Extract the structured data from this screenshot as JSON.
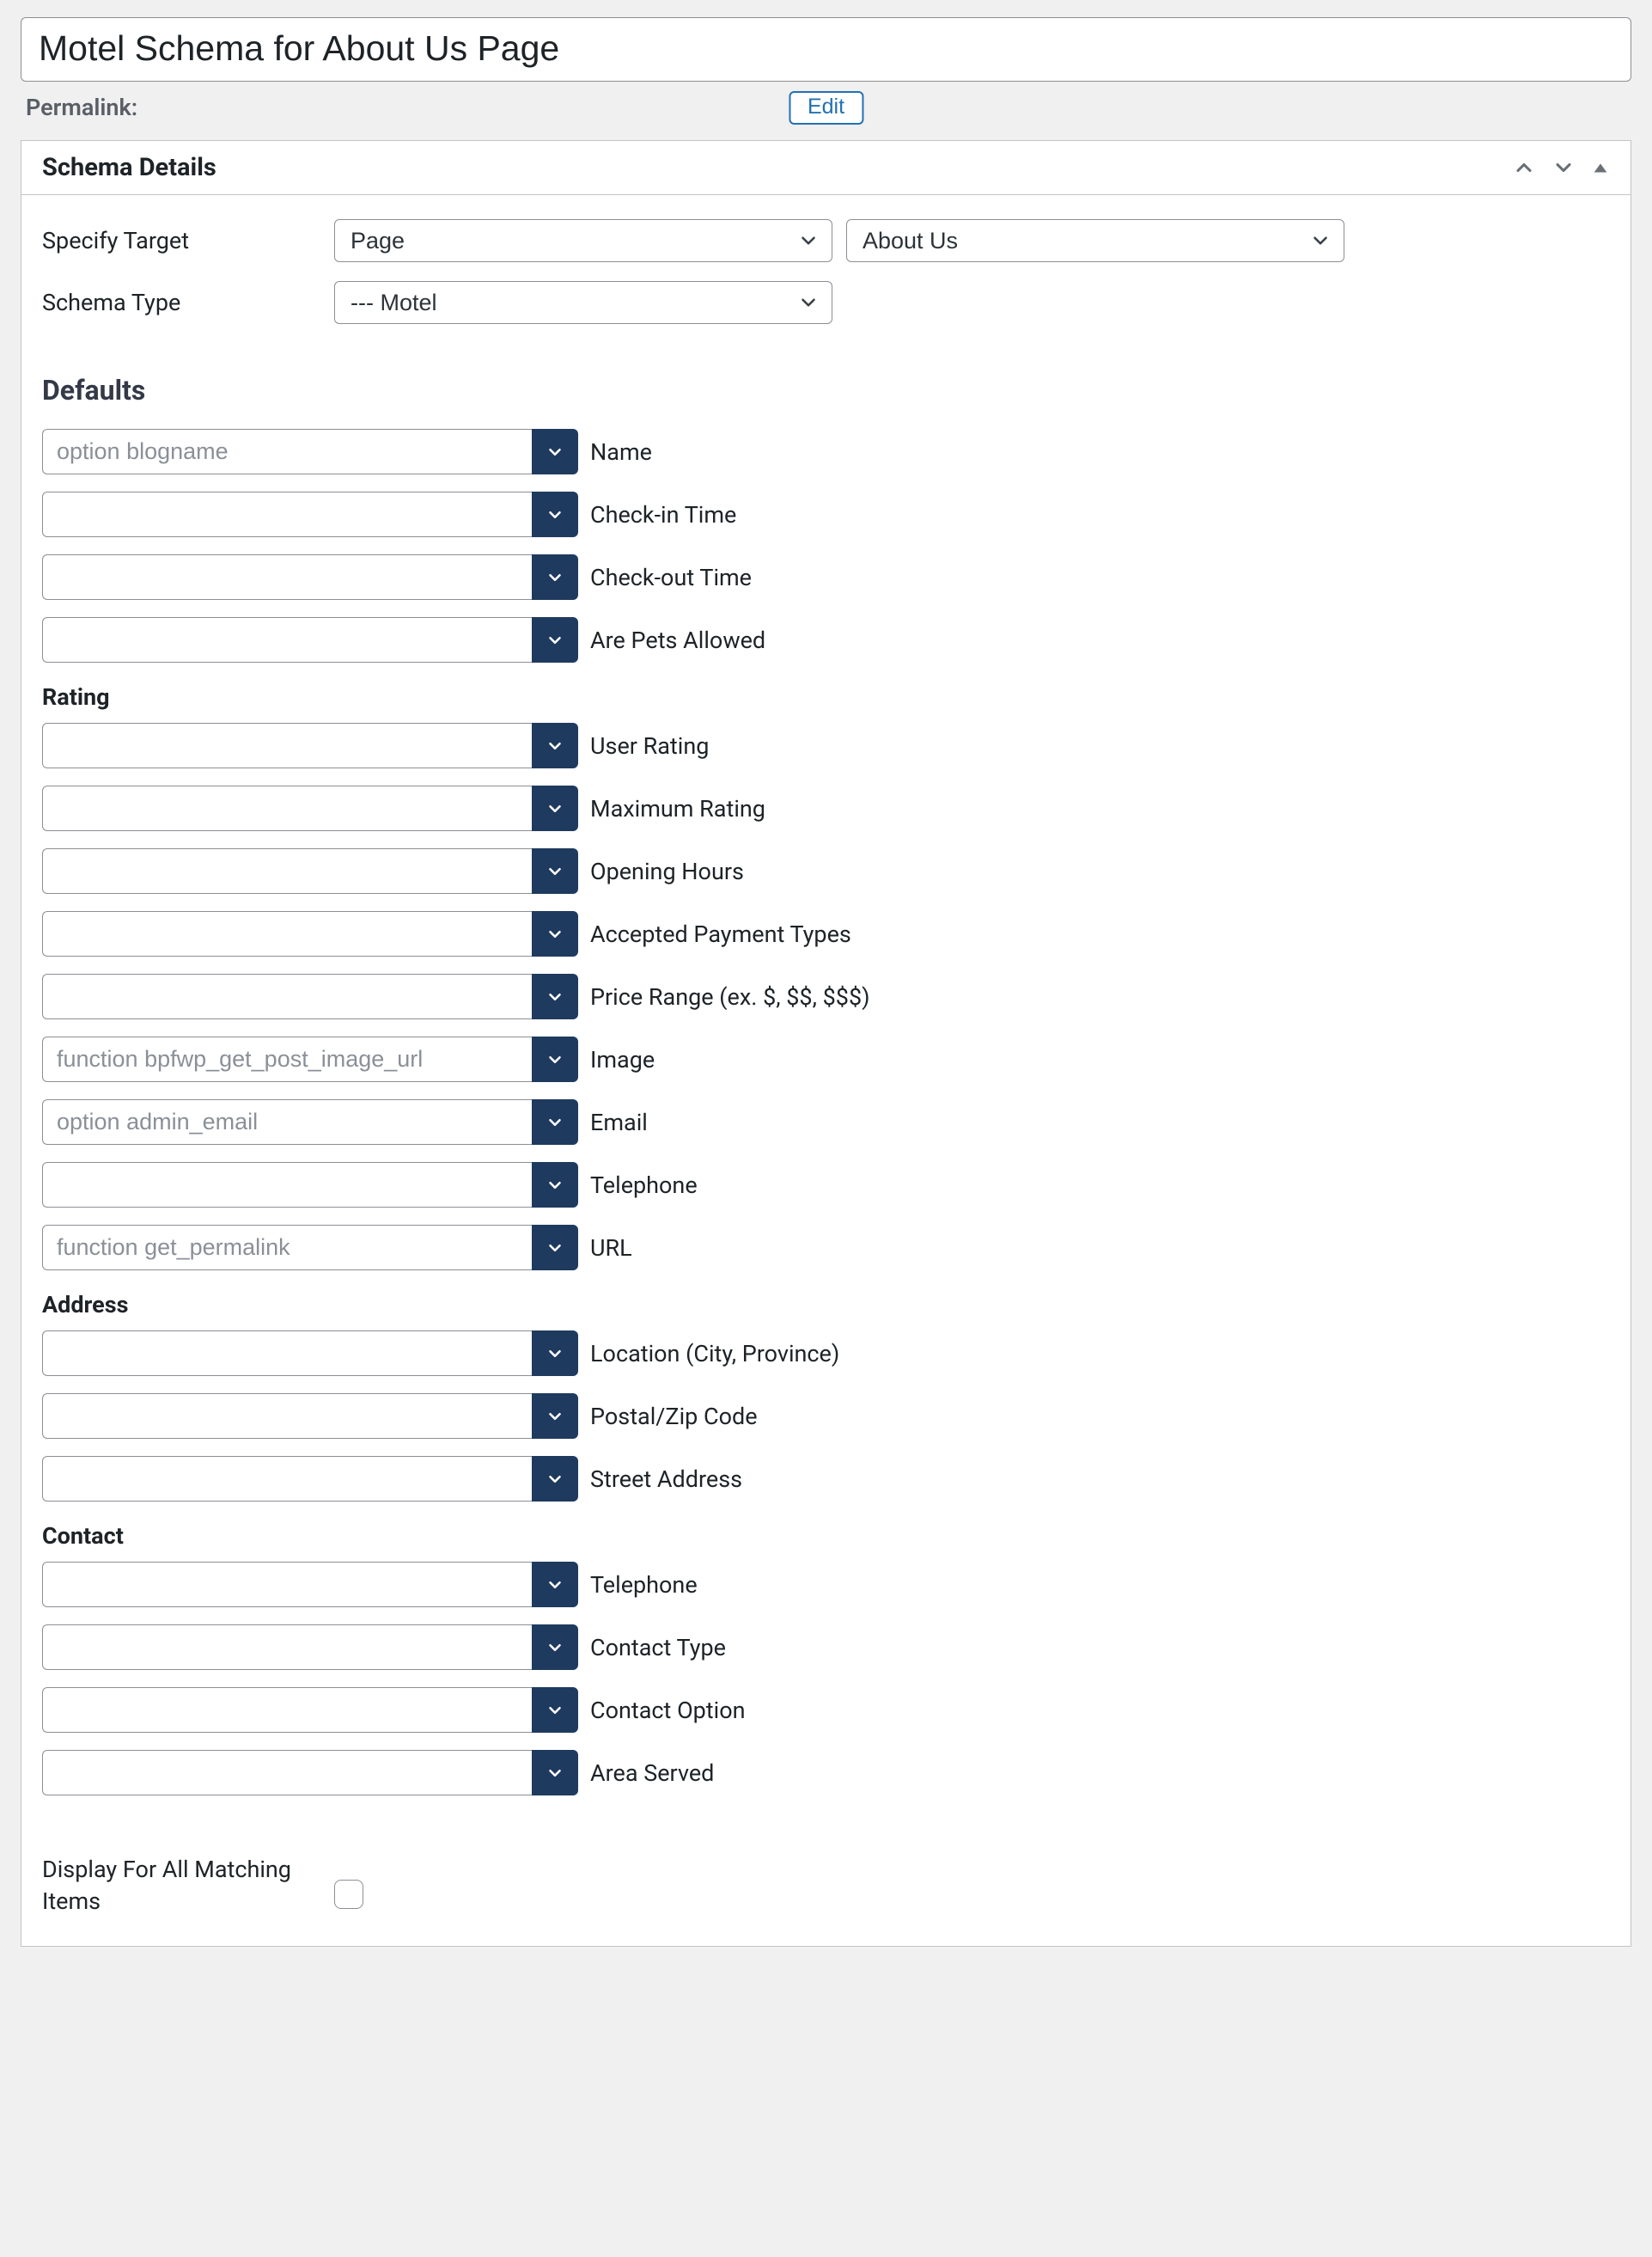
{
  "title": "Motel Schema for About Us Page",
  "permalink_label": "Permalink:",
  "edit_label": "Edit",
  "metabox_title": "Schema Details",
  "specify_target": {
    "label": "Specify Target",
    "value_a": "Page",
    "value_b": "About Us"
  },
  "schema_type": {
    "label": "Schema Type",
    "value": "--- Motel"
  },
  "defaults_heading": "Defaults",
  "rating_heading": "Rating",
  "address_heading": "Address",
  "contact_heading": "Contact",
  "fields": {
    "name": {
      "label": "Name",
      "placeholder": "option blogname"
    },
    "checkin": {
      "label": "Check-in Time",
      "placeholder": ""
    },
    "checkout": {
      "label": "Check-out Time",
      "placeholder": ""
    },
    "pets": {
      "label": "Are Pets Allowed",
      "placeholder": ""
    },
    "user_rating": {
      "label": "User Rating",
      "placeholder": ""
    },
    "max_rating": {
      "label": "Maximum Rating",
      "placeholder": ""
    },
    "opening_hours": {
      "label": "Opening Hours",
      "placeholder": ""
    },
    "payment_types": {
      "label": "Accepted Payment Types",
      "placeholder": ""
    },
    "price_range": {
      "label": "Price Range (ex. $, $$, $$$)",
      "placeholder": ""
    },
    "image": {
      "label": "Image",
      "placeholder": "function bpfwp_get_post_image_url"
    },
    "email": {
      "label": "Email",
      "placeholder": "option admin_email"
    },
    "telephone": {
      "label": "Telephone",
      "placeholder": ""
    },
    "url": {
      "label": "URL",
      "placeholder": "function get_permalink"
    },
    "location": {
      "label": "Location (City, Province)",
      "placeholder": ""
    },
    "postal": {
      "label": "Postal/Zip Code",
      "placeholder": ""
    },
    "street": {
      "label": "Street Address",
      "placeholder": ""
    },
    "c_telephone": {
      "label": "Telephone",
      "placeholder": ""
    },
    "c_type": {
      "label": "Contact Type",
      "placeholder": ""
    },
    "c_option": {
      "label": "Contact Option",
      "placeholder": ""
    },
    "c_area": {
      "label": "Area Served",
      "placeholder": ""
    }
  },
  "display_matching_label": "Display For All Matching Items"
}
